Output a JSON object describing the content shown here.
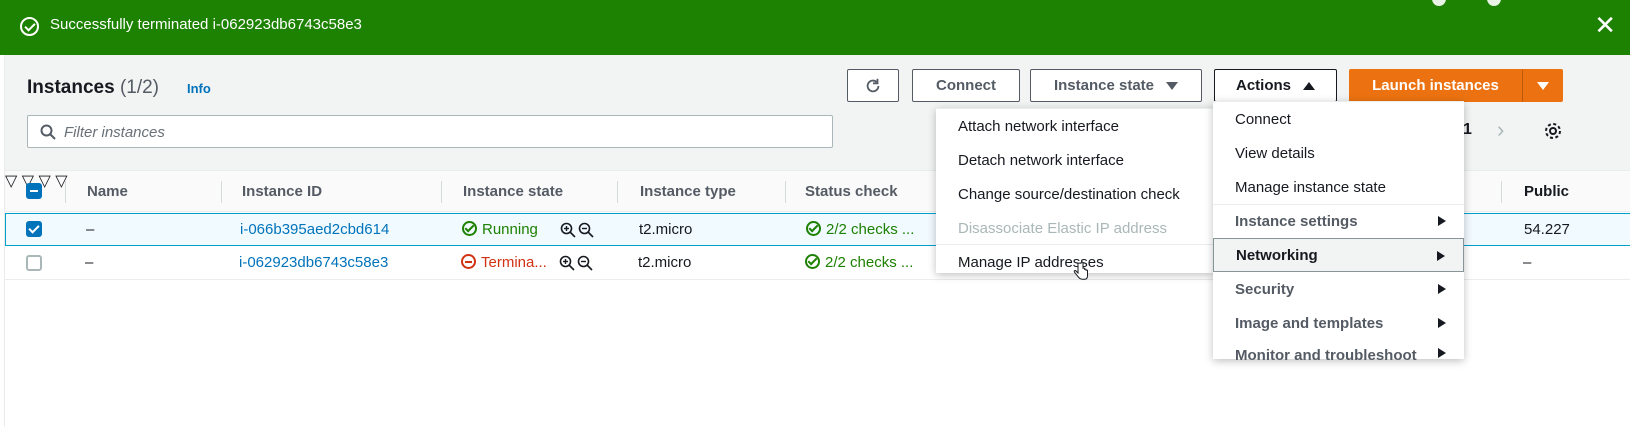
{
  "flash": {
    "message": "Successfully terminated i-062923db6743c58e3",
    "close_symbol": "✕",
    "color": "#1d8102"
  },
  "header": {
    "title": "Instances",
    "count": "(1/2)",
    "info_label": "Info"
  },
  "toolbar": {
    "connect_label": "Connect",
    "instance_state_label": "Instance state",
    "actions_label": "Actions",
    "launch_label": "Launch instances",
    "launch_color": "#ec7211"
  },
  "filter": {
    "placeholder": "Filter instances",
    "value": ""
  },
  "pagination": {
    "current_page": "1"
  },
  "table": {
    "columns": [
      "Name",
      "Instance ID",
      "Instance state",
      "Instance type",
      "Status check",
      "Public"
    ],
    "rows": [
      {
        "selected": true,
        "name": "–",
        "instance_id": "i-066b395aed2cbd614",
        "state": "Running",
        "type": "t2.micro",
        "status_check": "2/2 checks ...",
        "public": "54.227"
      },
      {
        "selected": false,
        "name": "–",
        "instance_id": "i-062923db6743c58e3",
        "state": "Termina...",
        "type": "t2.micro",
        "status_check": "2/2 checks ...",
        "public": "–"
      }
    ]
  },
  "actions_menu": {
    "items": [
      {
        "label": "Connect"
      },
      {
        "label": "View details"
      },
      {
        "label": "Manage instance state"
      },
      {
        "label": "Instance settings"
      },
      {
        "label": "Networking"
      },
      {
        "label": "Security"
      },
      {
        "label": "Image and templates"
      },
      {
        "label": "Monitor and troubleshoot"
      }
    ]
  },
  "networking_submenu": {
    "items": [
      {
        "label": "Attach network interface"
      },
      {
        "label": "Detach network interface"
      },
      {
        "label": "Change source/destination check"
      },
      {
        "label": "Disassociate Elastic IP address"
      },
      {
        "label": "Manage IP addresses"
      }
    ]
  }
}
